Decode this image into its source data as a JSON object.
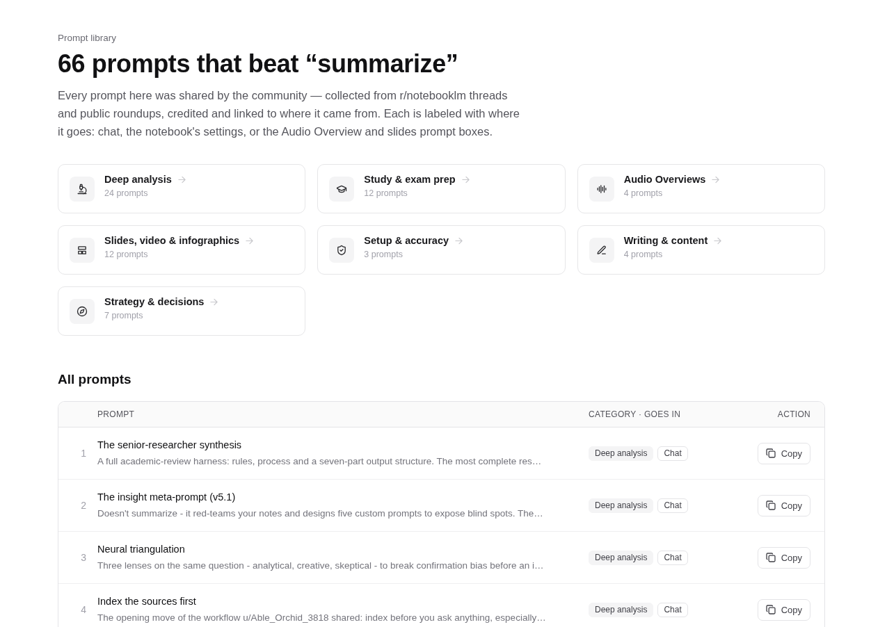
{
  "header": {
    "eyebrow": "Prompt library",
    "title": "66 prompts that beat “summarize”",
    "description": "Every prompt here was shared by the community — collected from r/notebooklm threads and public roundups, credited and linked to where it came from. Each is labeled with where it goes: chat, the notebook's settings, or the Audio Overview and slides prompt boxes."
  },
  "categories": [
    {
      "name": "Deep analysis",
      "count": "24 prompts"
    },
    {
      "name": "Study & exam prep",
      "count": "12 prompts"
    },
    {
      "name": "Audio Overviews",
      "count": "4 prompts"
    },
    {
      "name": "Slides, video & infographics",
      "count": "12 prompts"
    },
    {
      "name": "Setup & accuracy",
      "count": "3 prompts"
    },
    {
      "name": "Writing & content",
      "count": "4 prompts"
    },
    {
      "name": "Strategy & decisions",
      "count": "7 prompts"
    }
  ],
  "all_prompts": {
    "heading": "All prompts",
    "columns": [
      "PROMPT",
      "CATEGORY · GOES IN",
      "ACTION"
    ],
    "rows": [
      {
        "number": "1",
        "title": "The senior-researcher synthesis",
        "description": "A full academic-review harness: rules, process and a seven-part output structure. The most complete res…",
        "category": "Deep analysis",
        "goes_in": "Chat",
        "action": "Copy"
      },
      {
        "number": "2",
        "title": "The insight meta-prompt (v5.1)",
        "description": "Doesn't summarize - it red-teams your notes and designs five custom prompts to expose blind spots. The…",
        "category": "Deep analysis",
        "goes_in": "Chat",
        "action": "Copy"
      },
      {
        "number": "3",
        "title": "Neural triangulation",
        "description": "Three lenses on the same question - analytical, creative, skeptical - to break confirmation bias before an i…",
        "category": "Deep analysis",
        "goes_in": "Chat",
        "action": "Copy"
      },
      {
        "number": "4",
        "title": "Index the sources first",
        "description": "The opening move of the workflow u/Able_Orchid_3818 shared: index before you ask anything, especially…",
        "category": "Deep analysis",
        "goes_in": "Chat",
        "action": "Copy"
      }
    ]
  }
}
